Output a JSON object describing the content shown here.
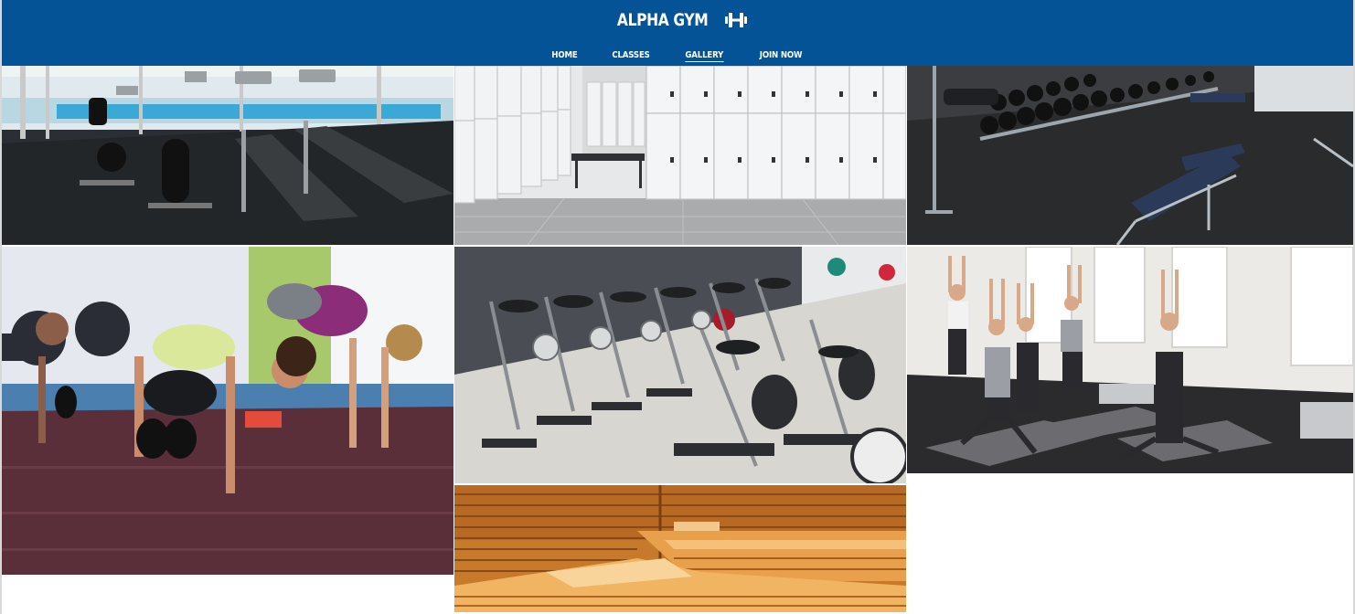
{
  "header": {
    "brand_name": "ALPHA GYM",
    "logo_icon": "dumbbell-icon",
    "background_color": "#045397"
  },
  "nav": {
    "items": [
      {
        "label": "HOME",
        "active": false
      },
      {
        "label": "CLASSES",
        "active": false
      },
      {
        "label": "GALLERY",
        "active": true
      },
      {
        "label": "JOIN NOW",
        "active": false
      }
    ]
  },
  "gallery": {
    "photos": [
      {
        "name": "cardio-room-photo"
      },
      {
        "name": "locker-room-photo"
      },
      {
        "name": "free-weights-photo"
      },
      {
        "name": "bootcamp-class-photo"
      },
      {
        "name": "spin-bikes-photo"
      },
      {
        "name": "yoga-class-photo"
      },
      {
        "name": "sauna-photo"
      }
    ]
  }
}
